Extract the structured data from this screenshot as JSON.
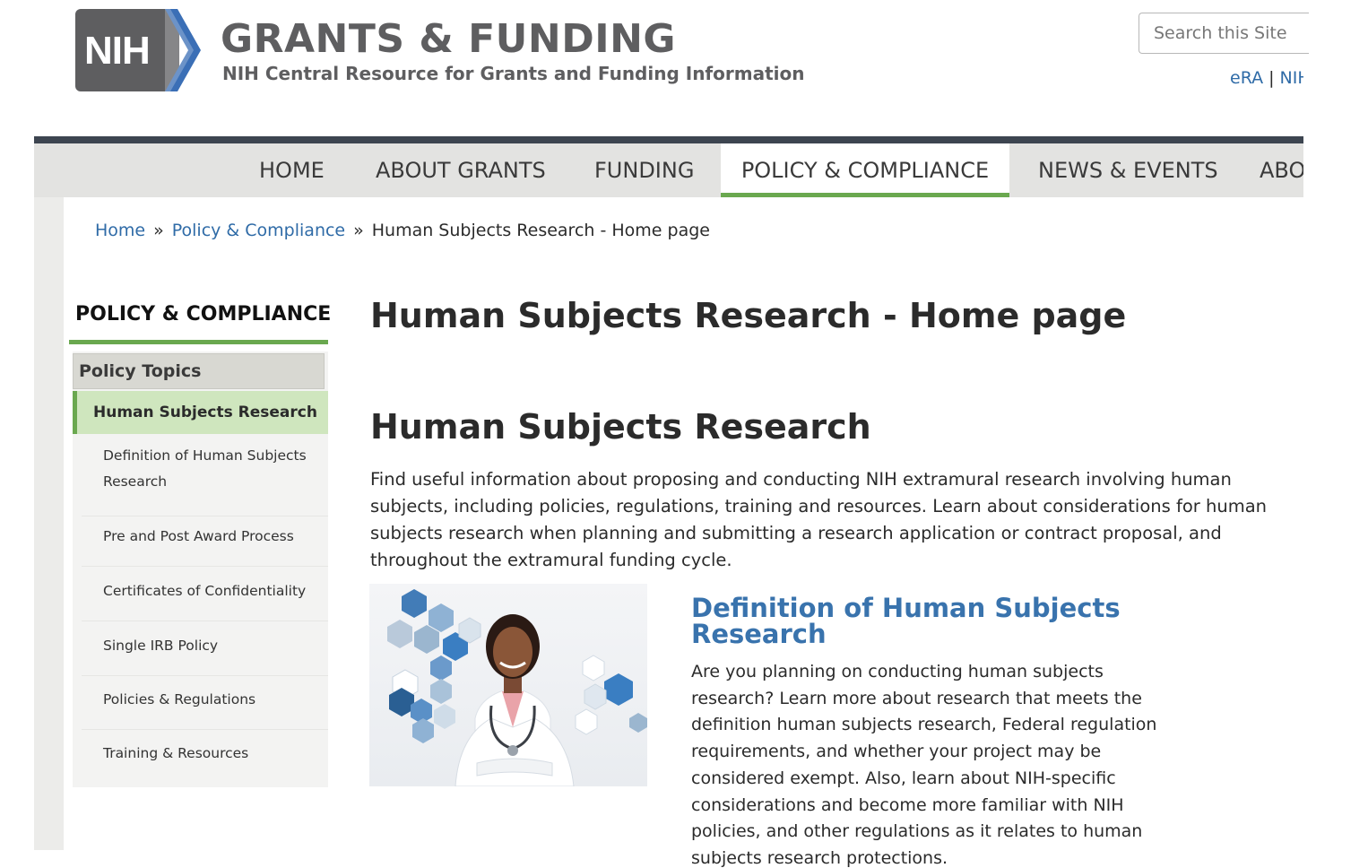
{
  "header": {
    "logo_text": "NIH",
    "title": "GRANTS & FUNDING",
    "subtitle": "NIH Central Resource for Grants and Funding Information",
    "search_placeholder": "Search this Site",
    "top_links": [
      "eRA",
      "NIH"
    ],
    "top_links_separator": "|"
  },
  "nav": {
    "items": [
      {
        "label": "HOME"
      },
      {
        "label": "ABOUT GRANTS"
      },
      {
        "label": "FUNDING"
      },
      {
        "label": "POLICY & COMPLIANCE",
        "active": true
      },
      {
        "label": "NEWS & EVENTS"
      },
      {
        "label": "ABOUT"
      }
    ]
  },
  "breadcrumb": {
    "items": [
      "Home",
      "Policy & Compliance",
      "Human Subjects Research - Home page"
    ],
    "separator": "»"
  },
  "sidebar": {
    "title": "POLICY & COMPLIANCE",
    "section_label": "Policy Topics",
    "active_item": "Human Subjects Research",
    "items": [
      {
        "label": "Definition of Human Subjects Research"
      },
      {
        "label": "Pre and Post Award Process"
      },
      {
        "label": "Certificates of Confidentiality"
      },
      {
        "label": "Single IRB Policy"
      },
      {
        "label": "Policies & Regulations"
      },
      {
        "label": "Training & Resources"
      }
    ]
  },
  "main": {
    "page_title": "Human Subjects Research - Home page",
    "section_title": "Human Subjects Research",
    "intro": "Find useful information about proposing and conducting NIH extramural research involving human subjects, including policies, regulations, training and resources.  Learn about considerations for human subjects research when planning and submitting a research application or contract proposal, and throughout the extramural funding cycle.",
    "card": {
      "title": "Definition of Human Subjects Research",
      "text": "Are you planning on conducting human subjects research? Learn more about research that meets the definition human subjects research, Federal regulation requirements, and whether your project may be considered exempt. Also, learn about NIH-specific considerations and become more familiar with NIH policies, and other regulations as it relates to human subjects research protections."
    }
  },
  "colors": {
    "brand_gray": "#5e5e60",
    "brand_blue": "#3b6fb6",
    "link_blue": "#2f6ba7",
    "accent_green": "#6aa84f",
    "active_green_bg": "#cfe6be",
    "nav_bg": "#e3e3e1"
  }
}
